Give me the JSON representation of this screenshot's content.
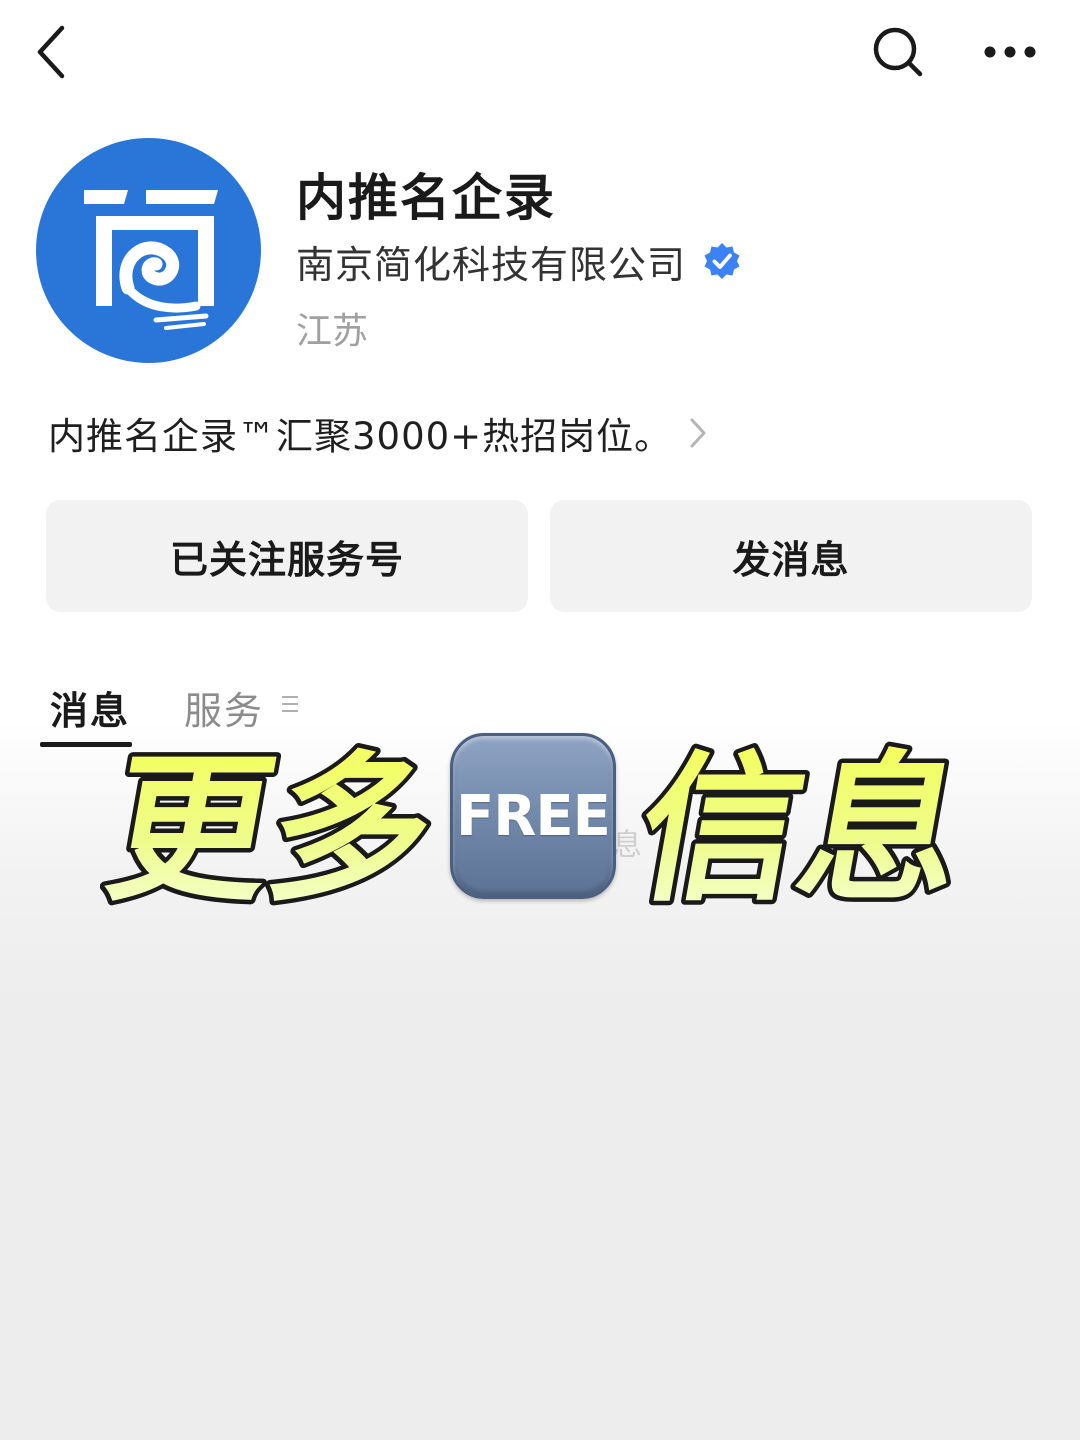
{
  "header": {
    "back_icon": "chevron-left-icon",
    "search_icon": "search-icon",
    "more_icon": "more-horizontal-icon"
  },
  "profile": {
    "title": "内推名企录",
    "company": "南京简化科技有限公司",
    "region": "江苏",
    "description": "内推名企录™汇聚3000+热招岗位。",
    "verified_color": "#3d82f5",
    "logo_color": "#2a76d8"
  },
  "actions": {
    "follow_label": "已关注服务号",
    "message_label": "发消息"
  },
  "tabs": {
    "messages_label": "消息",
    "services_label": "服务"
  },
  "banner": {
    "text_left": "更多",
    "badge": "FREE",
    "text_right": "信息",
    "faded_text": "息"
  }
}
